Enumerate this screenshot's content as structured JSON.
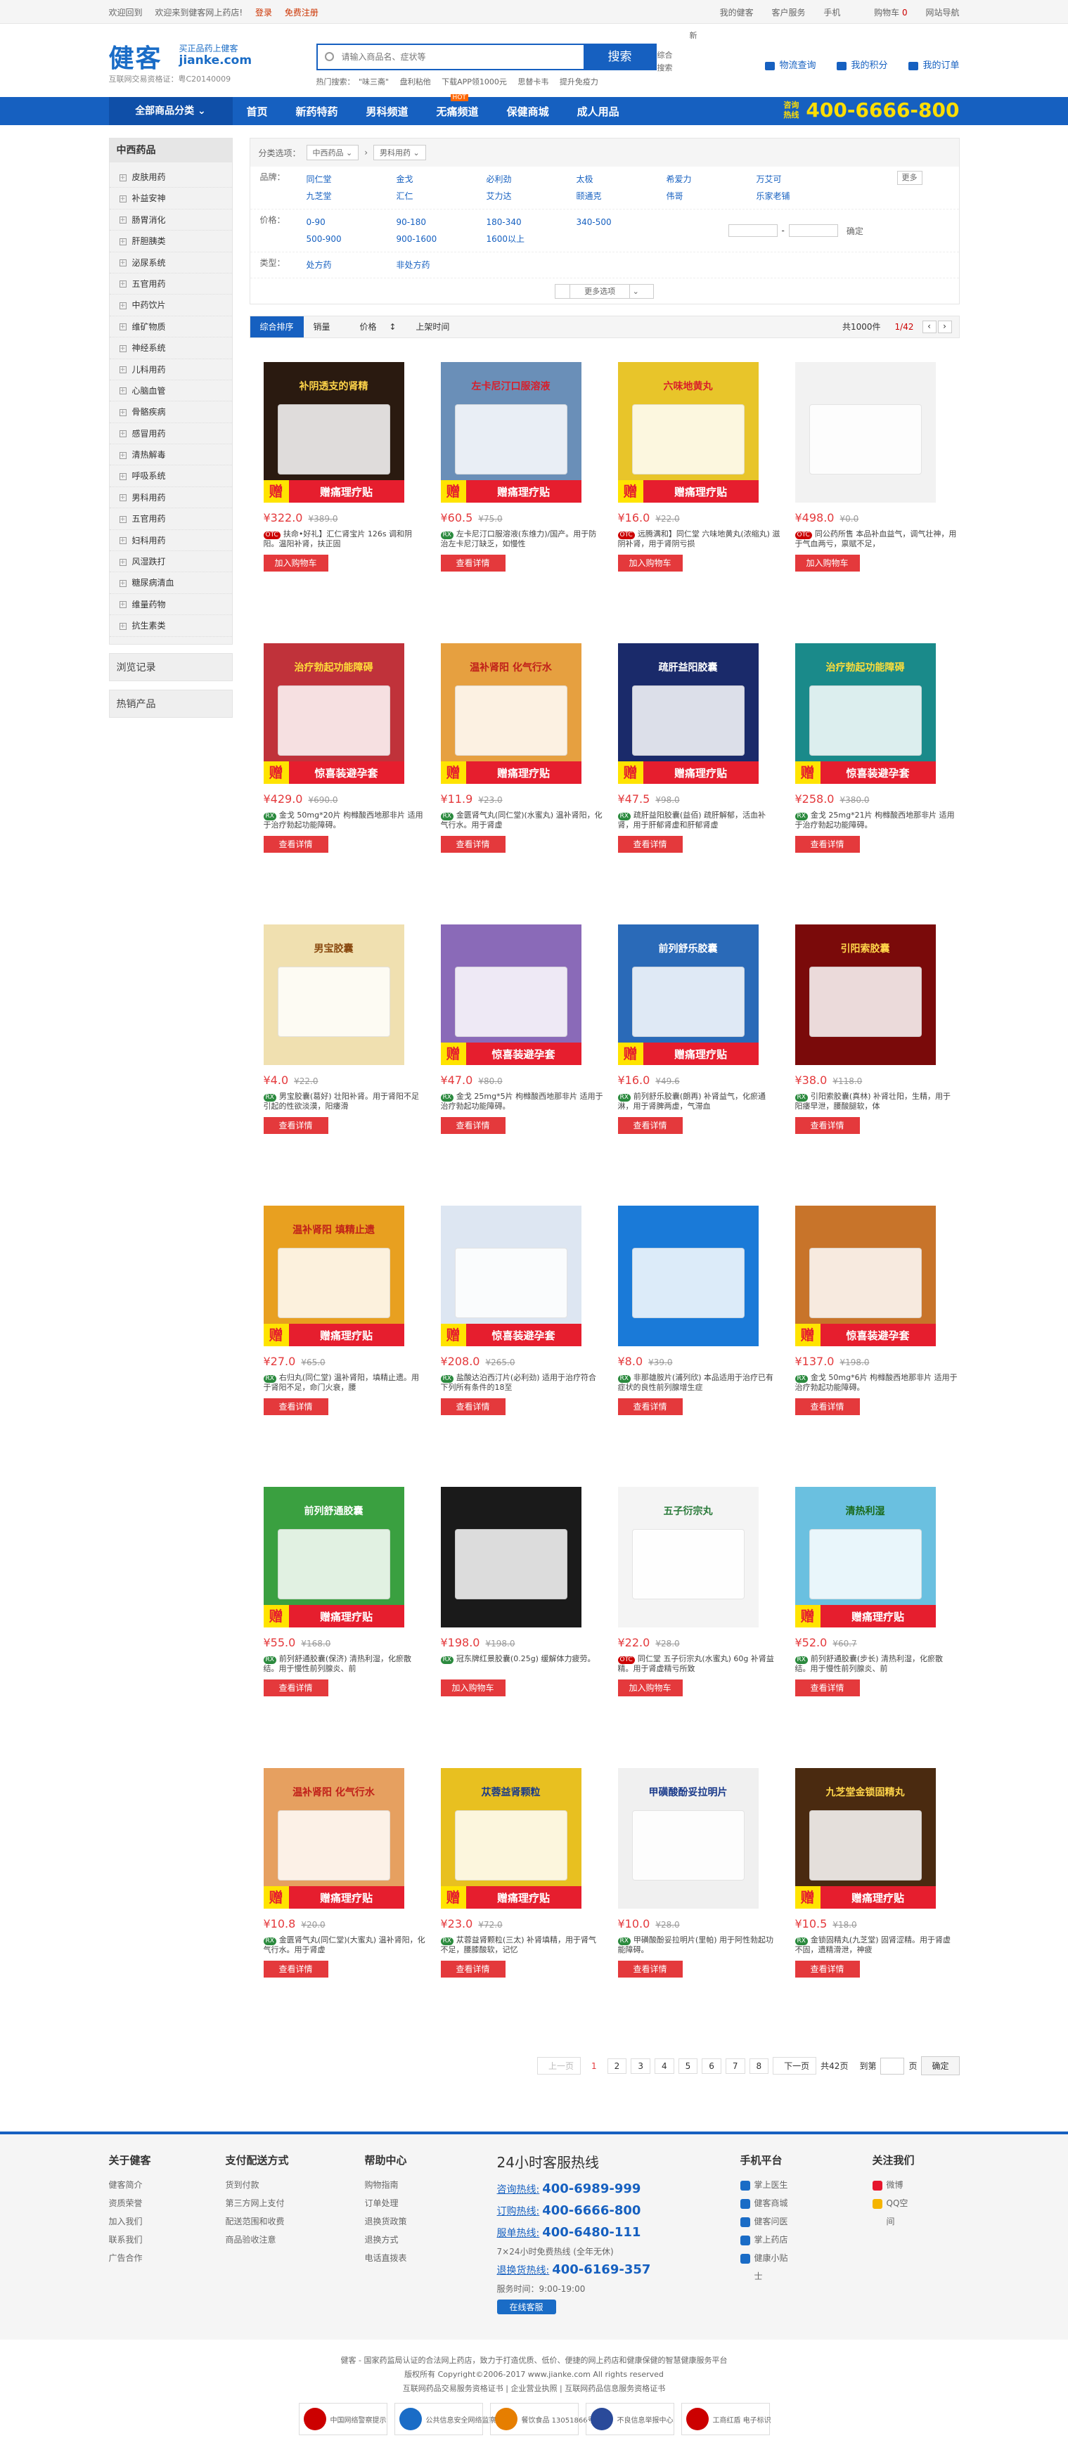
{
  "topbar": {
    "welcome": "欢迎回到",
    "welcome2": "欢迎来到健客网上药店!",
    "login": "登录",
    "register": "免费注册",
    "links": [
      "我的健客",
      "客户服务",
      "手机",
      "购物车",
      "网站导航"
    ],
    "cart_count": "0"
  },
  "logo": {
    "big": "健客",
    "tagline": "买正品药上健客",
    "domain": "jianke.com",
    "license": "互联网交易资格证：粤C20140009"
  },
  "search": {
    "placeholder": "请输入商品名、症状等",
    "button": "搜索",
    "hot_label": "热门搜索：",
    "hot": [
      "\"味三斋\"",
      "盘利粘他",
      "下载APP领1000元",
      "思替卡韦",
      "提升免疫力"
    ],
    "comp1": "综合",
    "comp2": "搜索",
    "dot": "新"
  },
  "header_links": [
    "物流查询",
    "我的积分",
    "我的订单"
  ],
  "nav": {
    "all": "全部商品分类",
    "items": [
      "首页",
      "新药特药",
      "男科频道",
      "无痛频道",
      "保健商城",
      "成人用品"
    ],
    "tag": "HOT",
    "hotline_label1": "咨询",
    "hotline_label2": "热线",
    "hotline": "400-6666-800"
  },
  "sidebar": {
    "title": "中西药品",
    "items": [
      "皮肤用药",
      "补益安神",
      "肠胃消化",
      "肝胆胰类",
      "泌尿系统",
      "五官用药",
      "中药饮片",
      "维矿物质",
      "神经系统",
      "儿科用药",
      "心脑血管",
      "骨骼疾病",
      "感冒用药",
      "清热解毒",
      "呼吸系统",
      "男科用药",
      "五官用药",
      "妇科用药",
      "风湿跌打",
      "糖尿病清血",
      "维量药物",
      "抗生素类"
    ],
    "browse": "浏览记录",
    "hot": "热销产品"
  },
  "filter": {
    "label": "分类选项：",
    "sel1": "中西药品",
    "sel2": "男科用药",
    "brand_label": "品牌：",
    "brands": [
      "同仁堂",
      "金戈",
      "必利劲",
      "太极",
      "希爱力",
      "万艾可",
      "九芝堂",
      "汇仁",
      "艾力达",
      "颐通克",
      "伟哥",
      "乐家老铺"
    ],
    "more": "更多",
    "price_label": "价格：",
    "prices": [
      "0-90",
      "90-180",
      "180-340",
      "340-500",
      "500-900",
      "900-1600",
      "1600以上"
    ],
    "price_ok": "确定",
    "type_label": "类型：",
    "types": [
      "处方药",
      "非处方药"
    ],
    "more_options": "更多选项"
  },
  "sort": {
    "tabs": [
      "综合排序",
      "销量",
      "价格",
      "上架时间"
    ],
    "total": "共1000件",
    "page": "1/42"
  },
  "products": [
    {
      "title": "补阴透支的肾精",
      "price": "¥322.0",
      "old": "¥389.0",
      "badge": "OTC",
      "desc": "扶命•好礼】汇仁肾宝片 126s 调和阴阳。温阳补肾，扶正固",
      "btn": "加入购物车",
      "gift": "赠痛理疗贴",
      "color": "#2a1a10",
      "lc": "#ffd54a"
    },
    {
      "title": "左卡尼汀口服溶液",
      "price": "¥60.5",
      "old": "¥75.0",
      "badge": "RX",
      "desc": "左卡尼汀口服溶液(东维力)/国产。用于防治左卡尼汀缺乏，如慢性",
      "btn": "查看详情",
      "gift": "赠痛理疗贴",
      "color": "#6a8fb8",
      "lc": "#d81e2a"
    },
    {
      "title": "六味地黄丸",
      "price": "¥16.0",
      "old": "¥22.0",
      "badge": "OTC",
      "desc": "远腾满和】同仁堂 六味地黄丸(浓缩丸) 滋阴补肾，用于肾阴亏损",
      "btn": "加入购物车",
      "gift": "赠痛理疗贴",
      "color": "#e8c52a",
      "lc": "#d81e2a"
    },
    {
      "title": "",
      "price": "¥498.0",
      "old": "¥0.0",
      "badge": "OTC",
      "desc": "同公药所售 本品补血益气，调气壮神，用于气血两亏，禀赋不足，",
      "btn": "加入购物车",
      "gift": "",
      "color": "#f2f2f2",
      "lc": "#999"
    },
    {
      "title": "治疗勃起功能障碍",
      "price": "¥429.0",
      "old": "¥690.0",
      "badge": "RX",
      "desc": "金戈 50mg*20片 枸橼酸西地那非片 适用于治疗勃起功能障碍。",
      "btn": "查看详情",
      "gift": "惊喜装避孕套",
      "color": "#c0323a",
      "lc": "#ffde3a"
    },
    {
      "title": "温补肾阳 化气行水",
      "price": "¥11.9",
      "old": "¥23.0",
      "badge": "RX",
      "desc": "金匮肾气丸(同仁堂)(水蜜丸) 温补肾阳，化气行水。用于肾虚",
      "btn": "查看详情",
      "gift": "赠痛理疗贴",
      "color": "#e6a040",
      "lc": "#c0201a"
    },
    {
      "title": "疏肝益阳胶囊",
      "price": "¥47.5",
      "old": "¥98.0",
      "badge": "RX",
      "desc": "疏肝益阳胶囊(益佰) 疏肝解郁，活血补肾，用于肝郁肾虚和肝郁肾虚",
      "btn": "查看详情",
      "gift": "赠痛理疗贴",
      "color": "#1a2a6a",
      "lc": "#fff"
    },
    {
      "title": "治疗勃起功能障碍",
      "price": "¥258.0",
      "old": "¥380.0",
      "badge": "RX",
      "desc": "金戈 25mg*21片 枸橼酸西地那非片 适用于治疗勃起功能障碍。",
      "btn": "查看详情",
      "gift": "惊喜装避孕套",
      "color": "#1a8a8a",
      "lc": "#ffde3a"
    },
    {
      "title": "男宝胶囊",
      "price": "¥4.0",
      "old": "¥22.0",
      "badge": "RX",
      "desc": "男宝胶囊(葛好) 壮阳补肾。用于肾阳不足引起的性欲淡漠，阳痿滑",
      "btn": "查看详情",
      "gift": "",
      "color": "#f0e0b0",
      "lc": "#8a4a10"
    },
    {
      "title": "",
      "price": "¥47.0",
      "old": "¥80.0",
      "badge": "RX",
      "desc": "金戈 25mg*5片 枸橼酸西地那非片 适用于治疗勃起功能障碍。",
      "btn": "查看详情",
      "gift": "惊喜装避孕套",
      "color": "#8a6ab8",
      "lc": "#fff"
    },
    {
      "title": "前列舒乐胶囊",
      "price": "¥16.0",
      "old": "¥49.6",
      "badge": "RX",
      "desc": "前列舒乐胶囊(朗再) 补肾益气，化瘀通淋，用于肾脾两虚，气滞血",
      "btn": "查看详情",
      "gift": "赠痛理疗贴",
      "color": "#2a6ab8",
      "lc": "#fff"
    },
    {
      "title": "引阳索胶囊",
      "price": "¥38.0",
      "old": "¥118.0",
      "badge": "RX",
      "desc": "引阳索胶囊(真林) 补肾壮阳，生精，用于阳痿早泄，腰酸腿软，体",
      "btn": "查看详情",
      "gift": "",
      "color": "#7a0a0a",
      "lc": "#ffd54a"
    },
    {
      "title": "温补肾阳 填精止遗",
      "price": "¥27.0",
      "old": "¥65.0",
      "badge": "RX",
      "desc": "右归丸(同仁堂) 温补肾阳，填精止遗。用于肾阳不足，命门火衰，腰",
      "btn": "查看详情",
      "gift": "赠痛理疗贴",
      "color": "#e8a020",
      "lc": "#c0201a"
    },
    {
      "title": "",
      "price": "¥208.0",
      "old": "¥265.0",
      "badge": "RX",
      "desc": "盐酸达泊西汀片(必利劲) 适用于治疗符合下列所有条件的18至",
      "btn": "查看详情",
      "gift": "惊喜装避孕套",
      "color": "#dde6f2",
      "lc": "#1a4a9a"
    },
    {
      "title": "",
      "price": "¥8.0",
      "old": "¥39.0",
      "badge": "RX",
      "desc": "非那雄胺片(浦列欣) 本品适用于治疗已有症状的良性前列腺增生症",
      "btn": "查看详情",
      "gift": "",
      "color": "#1a7ad8",
      "lc": "#fff"
    },
    {
      "title": "",
      "price": "¥137.0",
      "old": "¥198.0",
      "badge": "RX",
      "desc": "金戈 50mg*6片 枸橼酸西地那非片 适用于治疗勃起功能障碍。",
      "btn": "查看详情",
      "gift": "惊喜装避孕套",
      "color": "#c8742a",
      "lc": "#fff"
    },
    {
      "title": "前列舒通胶囊",
      "price": "¥55.0",
      "old": "¥168.0",
      "badge": "RX",
      "desc": "前列舒通胶囊(保济) 清热利湿，化瘀散结。用于慢性前列腺炎、前",
      "btn": "查看详情",
      "gift": "赠痛理疗贴",
      "color": "#3aa040",
      "lc": "#fff"
    },
    {
      "title": "",
      "price": "¥198.0",
      "old": "¥198.0",
      "badge": "RX",
      "desc": "冠东牌红景胶囊(0.25g) 缓解体力疲劳。",
      "btn": "加入购物车",
      "gift": "",
      "color": "#1a1a1a",
      "lc": "#ffb020"
    },
    {
      "title": "五子衍宗丸",
      "price": "¥22.0",
      "old": "¥28.0",
      "badge": "OTC",
      "desc": "同仁堂 五子衍宗丸(水蜜丸) 60g 补肾益精。用于肾虚精亏所致",
      "btn": "加入购物车",
      "gift": "",
      "color": "#f4f4f4",
      "lc": "#2a7a3a"
    },
    {
      "title": "清热利湿",
      "price": "¥52.0",
      "old": "¥60.7",
      "badge": "RX",
      "desc": "前列舒通胶囊(步长) 清热利湿，化瘀散结。用于慢性前列腺炎、前",
      "btn": "查看详情",
      "gift": "赠痛理疗贴",
      "color": "#6ac0e0",
      "lc": "#1a6a1a"
    },
    {
      "title": "温补肾阳 化气行水",
      "price": "¥10.8",
      "old": "¥20.0",
      "badge": "RX",
      "desc": "金匮肾气丸(同仁堂)(大蜜丸) 温补肾阳，化气行水。用于肾虚",
      "btn": "查看详情",
      "gift": "赠痛理疗贴",
      "color": "#e6a060",
      "lc": "#c0201a"
    },
    {
      "title": "苁蓉益肾颗粒",
      "price": "¥23.0",
      "old": "¥72.0",
      "badge": "RX",
      "desc": "苁蓉益肾颗粒(三太) 补肾填精，用于肾气不足，腰膝酸软，记忆",
      "btn": "查看详情",
      "gift": "赠痛理疗贴",
      "color": "#e8c020",
      "lc": "#1a3a8a"
    },
    {
      "title": "甲磺酸酚妥拉明片",
      "price": "¥10.0",
      "old": "¥28.0",
      "badge": "RX",
      "desc": "甲磺酸酚妥拉明片(里帕) 用于阿性勃起功能障碍。",
      "btn": "查看详情",
      "gift": "",
      "color": "#f0f0f0",
      "lc": "#1a3a8a"
    },
    {
      "title": "九芝堂金锁固精丸",
      "price": "¥10.5",
      "old": "¥18.0",
      "badge": "RX",
      "desc": "金锁固精丸(九芝堂) 固肾涩精。用于肾虚不固，遗精滑泄，神疲",
      "btn": "查看详情",
      "gift": "赠痛理疗贴",
      "color": "#4a2a10",
      "lc": "#ffd54a"
    }
  ],
  "pager": {
    "prev": "上一页",
    "pages": [
      "1",
      "2",
      "3",
      "4",
      "5",
      "6",
      "7",
      "8"
    ],
    "next": "下一页",
    "total": "共42页",
    "goto": "到第",
    "unit": "页",
    "ok": "确定"
  },
  "footer": {
    "cols": [
      {
        "title": "关于健客",
        "items": [
          "健客简介",
          "资质荣誉",
          "加入我们",
          "联系我们",
          "广告合作"
        ]
      },
      {
        "title": "支付配送方式",
        "items": [
          "货到付款",
          "第三方网上支付",
          "配送范围和收费",
          "商品验收注意"
        ]
      },
      {
        "title": "帮助中心",
        "items": [
          "购物指南",
          "订单处理",
          "退换货政策",
          "退换方式",
          "电话直拨表"
        ]
      }
    ],
    "hotline_title": "24小时客服热线",
    "lines": [
      {
        "k": "咨询热线:",
        "v": "400-6989-999"
      },
      {
        "k": "订购热线:",
        "v": "400-6666-800"
      },
      {
        "k": "服单热线:",
        "v": "400-6480-111"
      }
    ],
    "note": "7×24小时免费热线 (全年无休)",
    "refund_k": "退换货热线:",
    "refund_v": "400-6169-357",
    "service_time": "服务时间：9:00-19:00",
    "online": "在线客服",
    "app_title": "手机平台",
    "apps": [
      "掌上医生",
      "健客商城",
      "健客问医",
      "掌上药店",
      "健康小贴",
      "士"
    ],
    "follow_title": "关注我们",
    "follows": [
      "微博",
      "QQ空",
      "间"
    ],
    "copy1": "健客 - 国家药监局认证的合法网上药店，致力于打造优质、低价、便捷的网上药店和健康保健的智慧健康服务平台",
    "copy2": "版权所有 Copyright©2006-2017 www.jianke.com All rights reserved",
    "copy3": "互联网药品交易服务资格证书 | 企业营业执照 | 互联网药品信息服务资格证书",
    "badges": [
      "中国网络警察提示",
      "公共信息安全网络监察",
      "餐饮食品 13051866号",
      "不良信息举报中心",
      "工商红盾 电子标识"
    ]
  }
}
